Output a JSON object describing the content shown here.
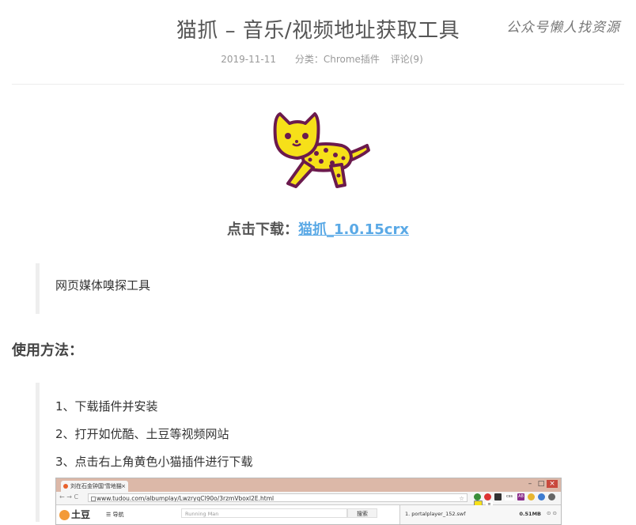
{
  "post": {
    "title": "猫抓 – 音乐/视频地址获取工具",
    "date": "2019-11-11",
    "category_label": "分类：",
    "category": "Chrome插件",
    "comments": "评论(9)"
  },
  "watermark": "公众号懒人找资源",
  "download": {
    "label": "点击下载：",
    "link_text": "猫抓_1.0.15crx"
  },
  "intro_quote": "网页媒体嗅探工具",
  "usage": {
    "heading": "使用方法：",
    "steps": [
      "1、下载插件并安装",
      "2、打开如优酷、土豆等视频网站",
      "3、点击右上角黄色小猫插件进行下载"
    ]
  },
  "screenshot": {
    "tab_title": "刘在石金钟国'雪地猫",
    "tab_close": "×",
    "window_buttons": [
      "–",
      "□",
      "×"
    ],
    "nav_buttons": "← → C",
    "url": "www.tudou.com/albumplay/LwzryqCl90o/3rzmVboxl2E.html",
    "site_logo": "土豆",
    "site_nav": "☰ 导航",
    "search_placeholder": "Running Man",
    "search_button": "搜索",
    "popup_file": "1. portalplayer_152.swf",
    "popup_size": "0.51MB",
    "ext_css": "css",
    "ext_ab": "AB"
  },
  "colors": {
    "link": "#5aa9e6",
    "quote_border": "#eeeeee",
    "divider": "#ececec",
    "cat_yellow": "#f6e019",
    "cat_outline": "#6b1a4d"
  },
  "icons": {
    "logo": "yellow-leopard-cat-icon"
  }
}
